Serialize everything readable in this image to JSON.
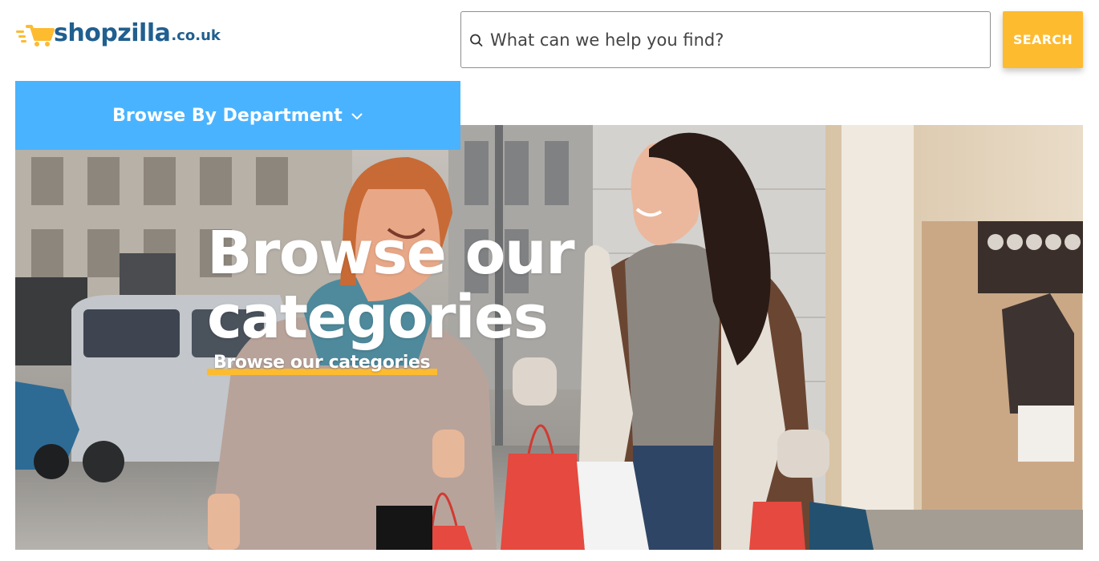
{
  "header": {
    "logo": {
      "brand": "shopzilla",
      "tld": ".co.uk",
      "icon": "shopping-cart-speed-icon",
      "colors": {
        "text": "#215f8f",
        "cart": "#fdbb30"
      }
    },
    "search": {
      "placeholder": "What can we help you find?",
      "value": "",
      "icon": "search-icon",
      "button_label": "SEARCH",
      "button_color": "#fdbb30"
    }
  },
  "nav": {
    "department_button": {
      "label": "Browse By Department",
      "icon": "chevron-down-icon",
      "color": "#4ab3ff"
    }
  },
  "hero": {
    "title": "Browse our categories",
    "link_label": "Browse our categories",
    "accent_color": "#fdbb30"
  }
}
